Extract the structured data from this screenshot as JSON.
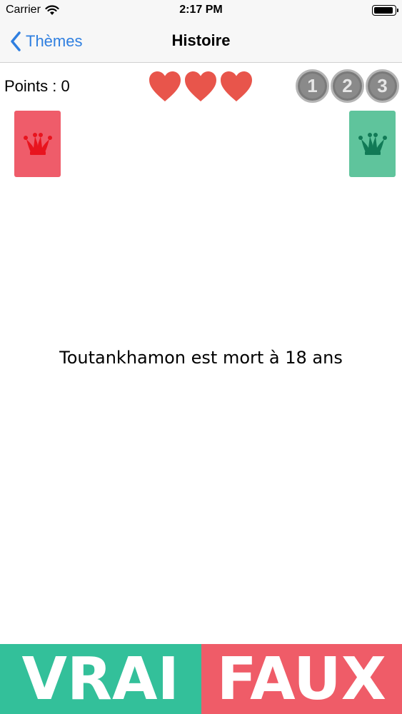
{
  "status_bar": {
    "carrier": "Carrier",
    "time": "2:17 PM",
    "wifi_icon": "wifi-icon",
    "battery_icon": "battery-icon"
  },
  "nav": {
    "back_label": "Thèmes",
    "back_icon": "chevron-left-icon",
    "title": "Histoire",
    "accent_color": "#2f7fe0"
  },
  "game": {
    "points_label": "Points : 0",
    "lives": 3,
    "heart_color": "#e8554b",
    "levels": [
      "1",
      "2",
      "3"
    ],
    "jokers": [
      {
        "icon": "jester-hat-icon",
        "color": "#ef5c6a"
      },
      {
        "icon": "jester-hat-icon",
        "color": "#5fc49c"
      }
    ]
  },
  "question": "Toutankhamon est mort à 18 ans",
  "answers": {
    "true_label": "VRAI",
    "true_color": "#33c09a",
    "false_label": "FAUX",
    "false_color": "#ef5c68"
  }
}
